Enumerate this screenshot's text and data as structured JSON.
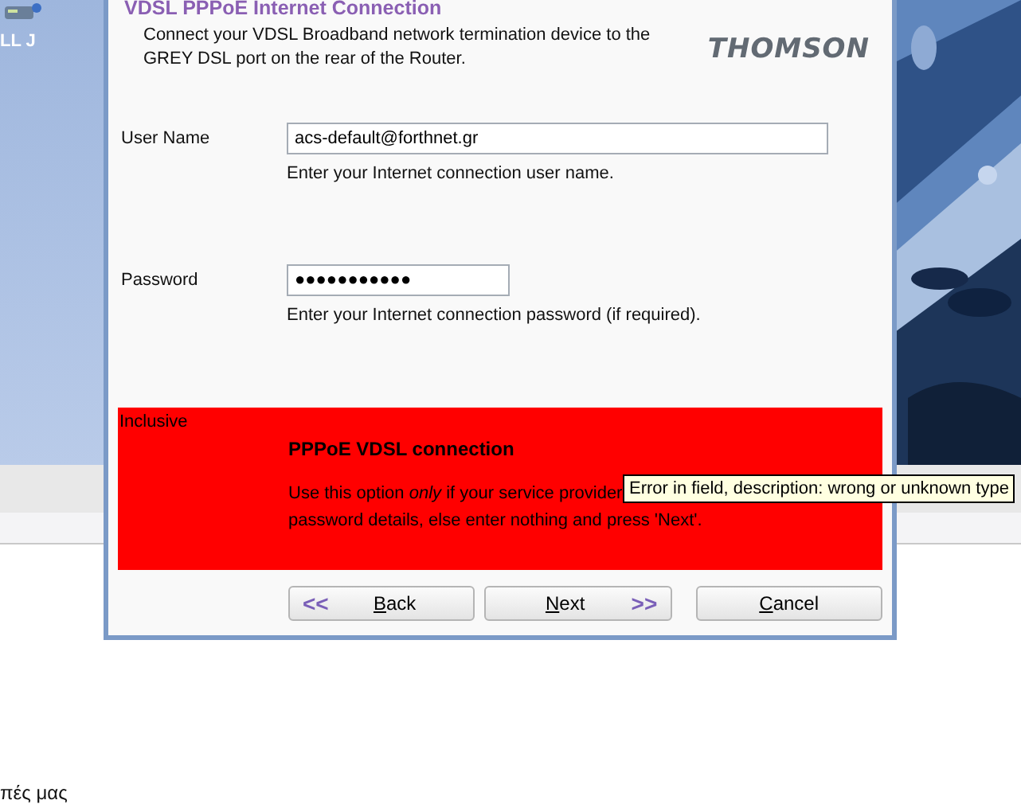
{
  "background": {
    "left_label": "LL J",
    "footer_text": "πές μας"
  },
  "dialog": {
    "title": "VDSL PPPoE Internet Connection",
    "intro": "Connect your VDSL Broadband network termination device to the GREY DSL port on the rear of the Router.",
    "logo": "THOMSON",
    "fields": [
      {
        "label": "User Name",
        "value": "acs-default@forthnet.gr",
        "kind": "text",
        "hint": "Enter your Internet connection user name."
      },
      {
        "label": "Password",
        "value": "●●●●●●●●●●●",
        "kind": "password",
        "hint": "Enter your Internet connection password (if required)."
      }
    ],
    "error_panel": {
      "tag": "Inclusive",
      "heading": "PPPoE VDSL connection",
      "lines": [
        "Use this option *only* if your service provider",
        "password details, else enter nothing and press 'Next'."
      ]
    },
    "tooltip": "Error in field, description: wrong or unknown type",
    "buttons": [
      {
        "label": "Back",
        "arrow": "<<",
        "kind": "back"
      },
      {
        "label": "Next",
        "arrow": ">>",
        "kind": "next"
      },
      {
        "label": "Cancel",
        "kind": "cancel"
      }
    ]
  }
}
